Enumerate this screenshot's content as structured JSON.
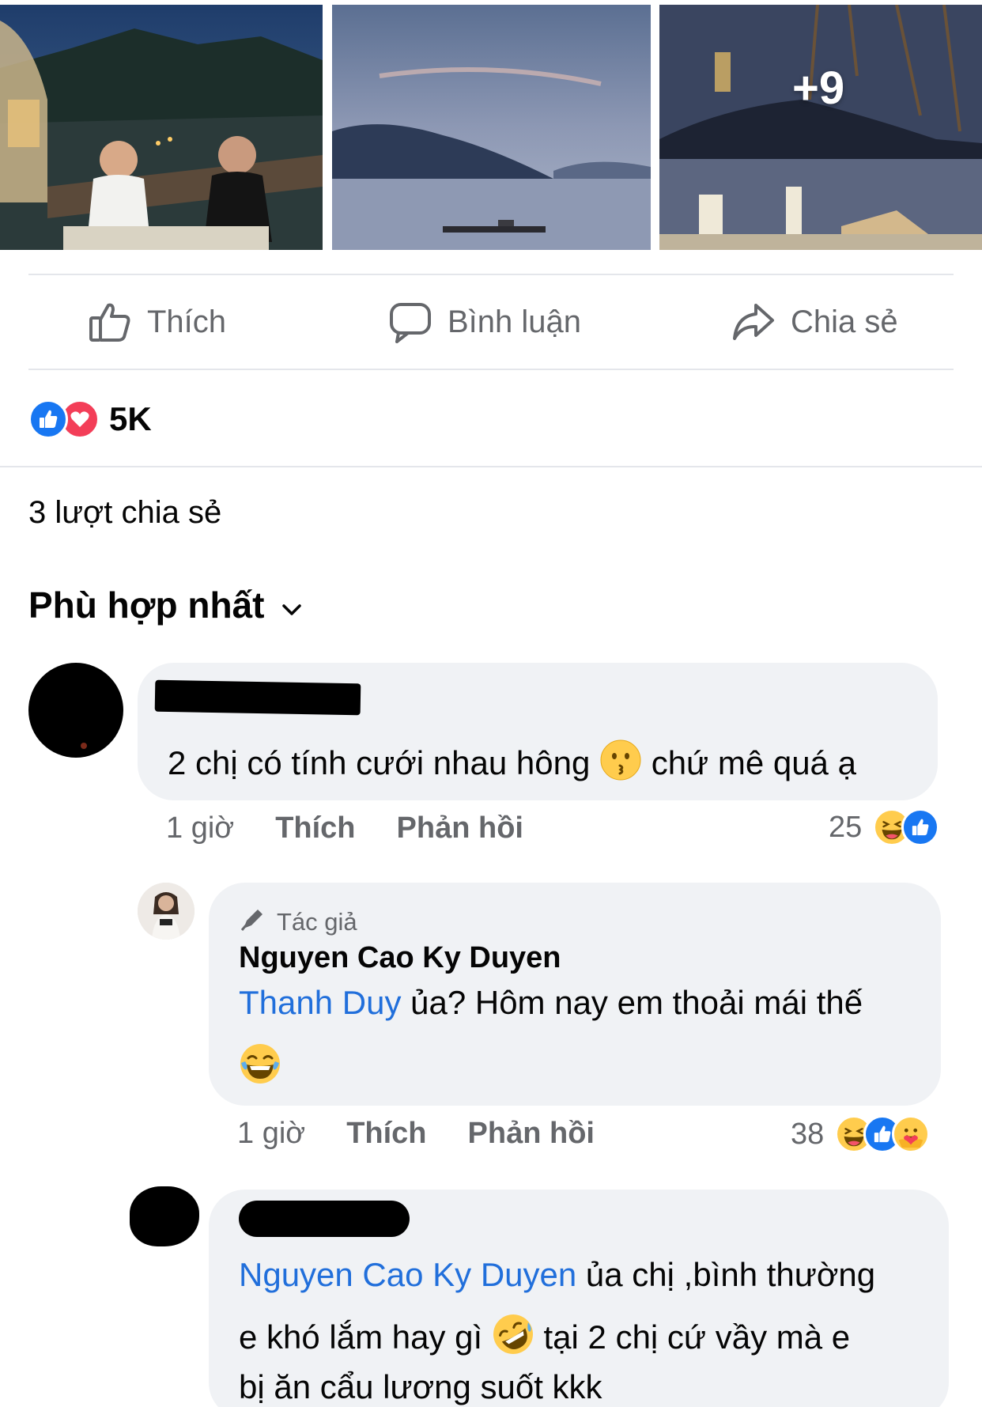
{
  "photos": {
    "more_count": "+9"
  },
  "actions": {
    "like_label": "Thích",
    "comment_label": "Bình luận",
    "share_label": "Chia sẻ"
  },
  "reactions": {
    "count": "5K",
    "types": [
      "like",
      "love"
    ]
  },
  "shares": "3 lượt chia sẻ",
  "sort": {
    "label": "Phù hợp nhất"
  },
  "comments": [
    {
      "text_before": "2 chị có tính cưới nhau hông",
      "emoji": "kissing-face",
      "text_after": "chứ mê quá ạ",
      "time": "1 giờ",
      "like_label": "Thích",
      "reply_label": "Phản hồi",
      "reaction_count": "25",
      "reaction_types": [
        "haha",
        "like"
      ]
    },
    {
      "badge": "Tác giả",
      "author": "Nguyen Cao Ky Duyen",
      "mention": "Thanh Duy",
      "text": "ủa? Hôm nay em thoải mái thế",
      "emoji": "tears-of-joy",
      "time": "1 giờ",
      "like_label": "Thích",
      "reply_label": "Phản hồi",
      "reaction_count": "38",
      "reaction_types": [
        "haha",
        "like",
        "care"
      ]
    },
    {
      "mention": "Nguyen Cao Ky Duyen",
      "line1": "ủa chị ,bình thường",
      "line2_before": "e khó lắm hay gì",
      "emoji": "rolling-laughing",
      "line2_after": "tại 2 chị cứ vầy mà e",
      "line3": "bị ăn cẩu lương suốt kkk"
    }
  ],
  "colors": {
    "accent": "#216fdb",
    "like_blue": "#1877f2",
    "love_red": "#f33e58",
    "bubble": "#f0f2f5",
    "muted": "#65676b"
  }
}
